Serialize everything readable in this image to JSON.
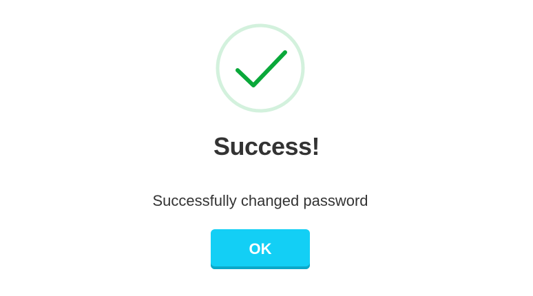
{
  "dialog": {
    "icon": "success-checkmark-icon",
    "title": "Success!",
    "message": "Successfully changed password",
    "ok_label": "OK"
  },
  "colors": {
    "ring": "#d3f1dd",
    "check": "#0aa83a",
    "title_text": "#333333",
    "button_bg": "#13cff5",
    "button_shadow": "#0aa8c9",
    "button_text": "#ffffff"
  }
}
